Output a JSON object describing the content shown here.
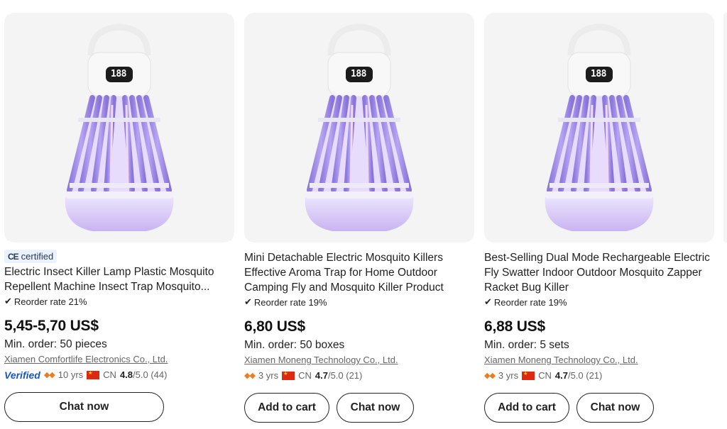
{
  "products": [
    {
      "badge": "certified",
      "badge_mark": "CE",
      "title": "Electric Insect Killer Lamp Plastic Mosquito Repellent Machine Insect Trap Mosquito...",
      "reorder": "Reorder rate 21%",
      "price": "5,45-5,70 US$",
      "moq": "Min. order: 50 pieces",
      "supplier": "Xiamen Comfortlife Electronics Co., Ltd.",
      "verified": "Verified",
      "years": "10 yrs",
      "country": "CN",
      "rating": "4.8",
      "rating_suffix": "/5.0 (44)",
      "buttons": [
        "Chat now"
      ],
      "display_digits": "188"
    },
    {
      "title": "Mini Detachable Electric Mosquito Killers Effective Aroma Trap for Home Outdoor Camping Fly and Mosquito Killer Product",
      "reorder": "Reorder rate 19%",
      "price": "6,80 US$",
      "moq": "Min. order: 50 boxes",
      "supplier": "Xiamen Moneng Technology Co., Ltd.",
      "years": "3 yrs",
      "country": "CN",
      "rating": "4.7",
      "rating_suffix": "/5.0 (21)",
      "buttons": [
        "Add to cart",
        "Chat now"
      ],
      "display_digits": "188"
    },
    {
      "title": "Best-Selling Dual Mode Rechargeable Electric Fly Swatter Indoor Outdoor Mosquito Zapper Racket Bug Killer",
      "reorder": "Reorder rate 19%",
      "price": "6,88 US$",
      "moq": "Min. order: 5 sets",
      "supplier": "Xiamen Moneng Technology Co., Ltd.",
      "years": "3 yrs",
      "country": "CN",
      "rating": "4.7",
      "rating_suffix": "/5.0 (21)",
      "buttons": [
        "Add to cart",
        "Chat now"
      ],
      "display_digits": "188"
    }
  ],
  "icons": {
    "check": "check-icon",
    "gem": "gold-supplier-gem-icon",
    "flag": "china-flag-icon"
  },
  "colors": {
    "verified": "#1756c8",
    "gem": "#f07a1c",
    "lamp_purple": "#9b84e8",
    "lamp_base": "#d8c8f4"
  }
}
